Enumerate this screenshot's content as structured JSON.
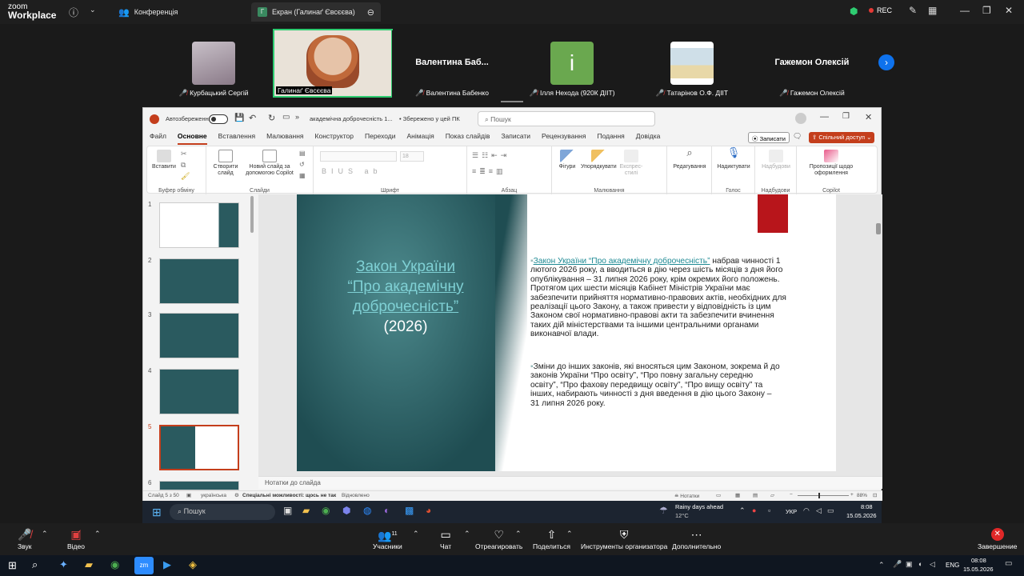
{
  "zoom": {
    "brand_top": "zoom",
    "brand_bottom": "Workplace",
    "tabs": [
      {
        "label": "Конференція"
      },
      {
        "label": "Екран (Галинаґ Євсєєва)",
        "icon": "Г"
      }
    ],
    "rec_label": "REC"
  },
  "gallery": {
    "tiles": [
      {
        "name": "Курбацький Сергій",
        "photo_color": "#b0a8b4"
      },
      {
        "name": "Галинаґ Євсєєва",
        "photo_color": "#d8c8b0"
      },
      {
        "name": "Валентина Бабенко",
        "big_name": "Валентина  Баб..."
      },
      {
        "name": "Ілля Нехода (920К ДІІТ)",
        "avatar_letter": "i",
        "avatar_color": "#6aa84f"
      },
      {
        "name": "Татарінов О.Ф. ДІІТ",
        "photo_color": "#c9d6e0"
      },
      {
        "name": "Гажемон Олексій",
        "big_name": "Гажемон Олексій"
      }
    ]
  },
  "ppt": {
    "autosave": "Автозбереження",
    "doc_title": "академічна доброчесність 1...",
    "saved": "• Збережено у цей ПК",
    "search_placeholder": "Пошук",
    "menu": [
      "Файл",
      "Основне",
      "Вставлення",
      "Малювання",
      "Конструктор",
      "Переходи",
      "Анімація",
      "Показ слайдів",
      "Записати",
      "Рецензування",
      "Подання",
      "Довідка"
    ],
    "record_btn": "Записати",
    "share_btn": "Спільний доступ",
    "ribbon": {
      "paste": "Вставити",
      "clipboard": "Буфер обміну",
      "new_slide": "Створити слайд",
      "copilot_slide": "Новий слайд за допомогою Copilot",
      "slides": "Слайди",
      "font_size": "18",
      "font": "Шрифт",
      "paragraph": "Абзац",
      "shapes": "Фігури",
      "arrange": "Упорядкувати",
      "quick_styles": "Експрес-стилі",
      "drawing": "Малювання",
      "editing": "Редагування",
      "dictate": "Надиктувати",
      "voice": "Голос",
      "addins_btn": "Надбудови",
      "addins": "Надбудови",
      "copilot_design": "Пропозиції щодо оформлення",
      "copilot": "Copilot"
    },
    "thumbs": [
      "1",
      "2",
      "3",
      "4",
      "5",
      "6"
    ],
    "slide": {
      "title_l1": "Закон України",
      "title_l2": "“Про академічну",
      "title_l3": "доброчесність”",
      "year": "(2026)",
      "p1_link": "Закон України “Про академічну доброчесність”",
      "p1_rest": " набрав чинності 1 лютого 2026 року, а вводиться в дію через шість місяців з дня його опублікування – 31 липня 2026 року, крім окремих його положень. Протягом цих шести місяців Кабінет Міністрів України має забезпечити прийняття нормативно-правових актів, необхідних для реалізації цього Закону, а також  привести у відповідність із цим Законом свої нормативно-правові акти та забезпечити вчинення таких дій міністерствами та іншими центральними органами виконавчої влади.",
      "p2": "Зміни до інших законів, які вносяться цим Законом, зокрема й до законів України “Про освіту”, “Про повну загальну середню освіту”, “Про фахову передвищу освіту”, “Про вищу освіту” та інших, набирають чинності з дня введення в дію цього Закону – 31 липня 2026 року."
    },
    "notes": "Нотатки до слайда",
    "status": {
      "slide_no": "Слайд 5 з 50",
      "lang": "українська",
      "access": "Спеціальні можливості: щось не так",
      "display": "Відновлено",
      "notes_btn": "Нотатки",
      "zoom_pct": "88%"
    }
  },
  "inner_taskbar": {
    "search": "Пошук",
    "weather_l1": "Rainy days ahead",
    "weather_l2": "12°C",
    "lang": "УКР",
    "time": "8:08",
    "date": "15.05.2026"
  },
  "controls": {
    "audio": "Звук",
    "video": "Відео",
    "participants": "Учасники",
    "participants_count": "11",
    "chat": "Чат",
    "react": "Отреагировать",
    "share": "Поделиться",
    "host_tools": "Инструменты организатора",
    "more": "Дополнительно",
    "end": "Завершение"
  },
  "os_taskbar": {
    "lang": "ENG",
    "time": "08:08",
    "date": "15.05.2026"
  }
}
